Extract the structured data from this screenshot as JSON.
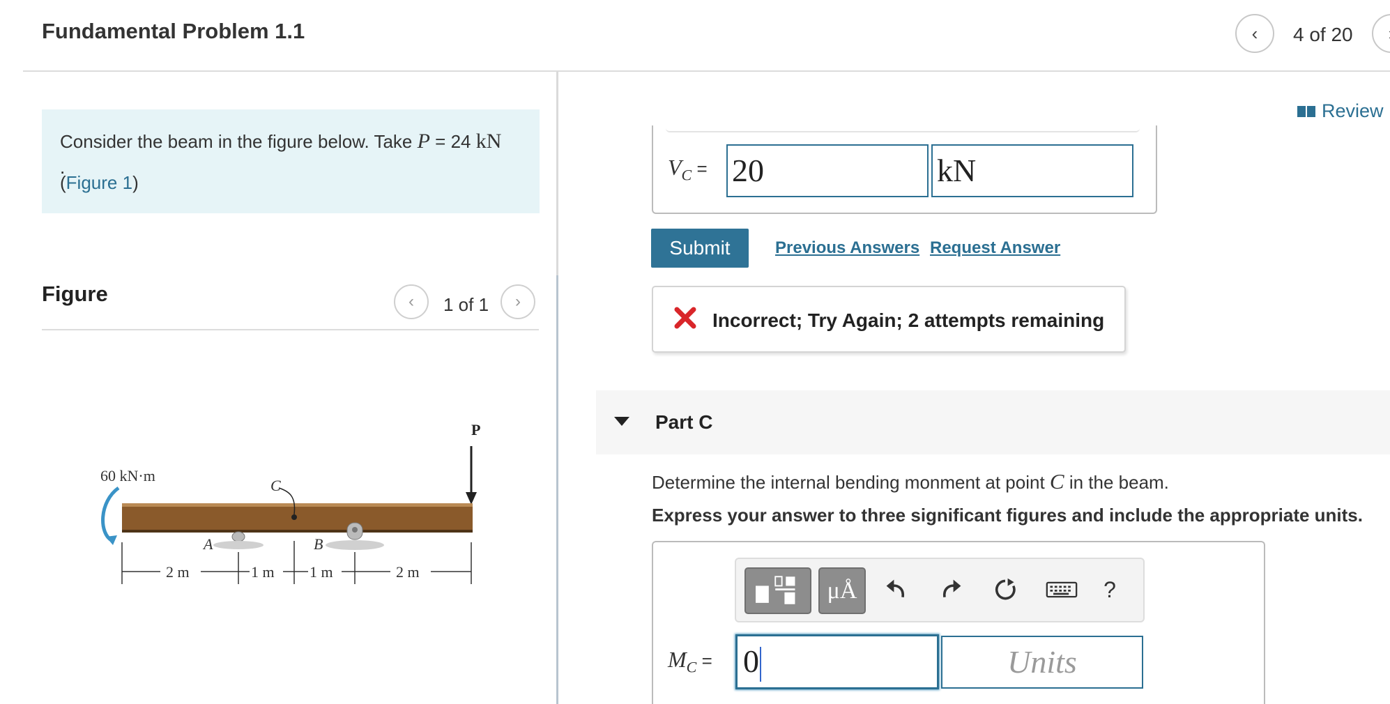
{
  "header": {
    "title": "Fundamental Problem 1.1",
    "counter": "4 of 20",
    "prev_icon": "chevron-left-icon",
    "next_icon": "chevron-right-icon"
  },
  "prompt": {
    "text_before": "Consider the beam in the figure below. Take ",
    "var": "P",
    "eq": " = 24 ",
    "unit": "kN",
    "dot": ".",
    "figure_link_open": "(",
    "figure_link": "Figure 1",
    "figure_link_close": ")"
  },
  "figure": {
    "heading": "Figure",
    "counter": "1 of 1",
    "labels": {
      "moment": "60 kN·m",
      "load": "P",
      "point_a": "A",
      "point_b": "B",
      "point_c": "C",
      "dim_1": "2 m",
      "dim_2": "1 m",
      "dim_3": "1 m",
      "dim_4": "2 m"
    }
  },
  "review": {
    "label": "Review",
    "icon": "book-icon"
  },
  "part_b": {
    "label_var": "V",
    "label_sub": "C",
    "label_eq": " =",
    "value": "20",
    "unit": "kN",
    "submit": "Submit",
    "previous_answers": "Previous Answers",
    "request_answer": "Request Answer",
    "feedback": "Incorrect; Try Again; 2 attempts remaining",
    "feedback_color": "#d9262a"
  },
  "part_c": {
    "title": "Part C",
    "question_before": "Determine the internal bending monment at point ",
    "question_var": "C",
    "question_after": " in the beam.",
    "instructions": "Express your answer to three significant figures and include the appropriate units.",
    "toolbar": {
      "units_label": "μÅ",
      "help_label": "?",
      "icons": [
        "templates-icon",
        "units-icon",
        "undo-icon",
        "redo-icon",
        "reset-icon",
        "keyboard-icon",
        "help-icon"
      ]
    },
    "label_var": "M",
    "label_sub": "C",
    "label_eq": " =",
    "value": "0",
    "units_placeholder": "Units"
  },
  "colors": {
    "link": "#2b6f92",
    "submit_bg": "#2f7396",
    "prompt_bg": "#e6f4f7",
    "beam": "#8a5a2b"
  }
}
